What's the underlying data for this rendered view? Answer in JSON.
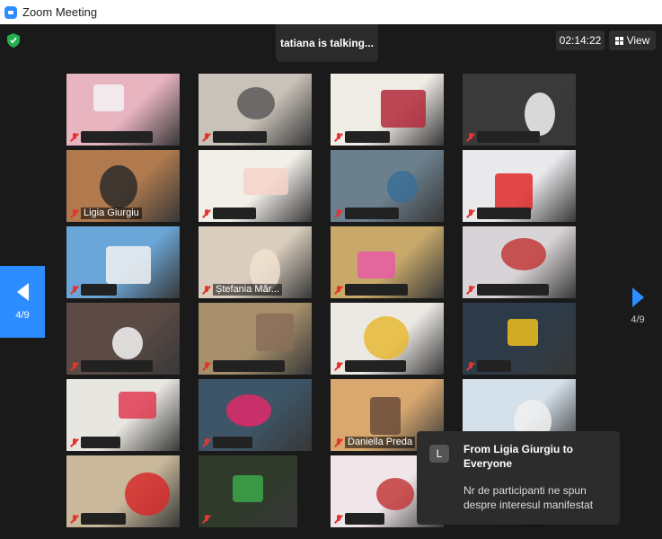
{
  "window": {
    "title": "Zoom Meeting"
  },
  "top_bar": {
    "talking_label": "tatiana is talking...",
    "timer": "02:14:22",
    "view_label": "View"
  },
  "pagination": {
    "left_label": "4/9",
    "right_label": "4/9"
  },
  "participants": [
    {
      "name": ""
    },
    {
      "name": ""
    },
    {
      "name": ""
    },
    {
      "name": ""
    },
    {
      "name": "Ligia Giurgiu"
    },
    {
      "name": ""
    },
    {
      "name": ""
    },
    {
      "name": ""
    },
    {
      "name": ""
    },
    {
      "name": "Ștefania Măr..."
    },
    {
      "name": ""
    },
    {
      "name": ""
    },
    {
      "name": ""
    },
    {
      "name": ""
    },
    {
      "name": ""
    },
    {
      "name": ""
    },
    {
      "name": ""
    },
    {
      "name": ""
    },
    {
      "name": "Daniella Preda"
    },
    {
      "name": ""
    },
    {
      "name": ""
    },
    {
      "name": ""
    },
    {
      "name": ""
    },
    {
      "name": ""
    }
  ],
  "chat": {
    "avatar_letter": "L",
    "from": "From Ligia Giurgiu to Everyone",
    "message": "Nr de participanti ne spun despre interesul manifestat"
  },
  "colors": {
    "accent": "#2D8CFF",
    "muted_mic": "#e5342f",
    "shield": "#22b14c"
  }
}
